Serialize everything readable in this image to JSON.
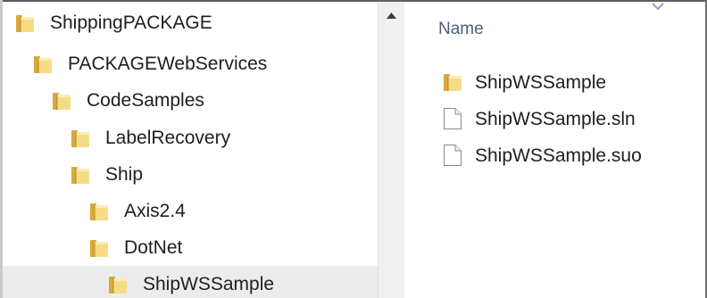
{
  "navigation": {
    "tree": [
      {
        "label": "ShippingPACKAGE",
        "level": 0,
        "selected": false
      },
      {
        "label": "PACKAGEWebServices",
        "level": 1,
        "selected": false
      },
      {
        "label": "CodeSamples",
        "level": 2,
        "selected": false
      },
      {
        "label": "LabelRecovery",
        "level": 3,
        "selected": false
      },
      {
        "label": "Ship",
        "level": 3,
        "selected": false
      },
      {
        "label": "Axis2.4",
        "level": 4,
        "selected": false
      },
      {
        "label": "DotNet",
        "level": 4,
        "selected": false
      },
      {
        "label": "ShipWSSample",
        "level": 5,
        "selected": true
      }
    ]
  },
  "content": {
    "column_header": "Name",
    "items": [
      {
        "name": "ShipWSSample",
        "type": "folder"
      },
      {
        "name": "ShipWSSample.sln",
        "type": "file"
      },
      {
        "name": "ShipWSSample.suo",
        "type": "file"
      }
    ]
  },
  "colors": {
    "folder_light": "#f6dc85",
    "folder_dark": "#d9a93a",
    "header_text": "#4c607a",
    "selection": "#ececec"
  },
  "icons": {
    "folder": "folder-icon",
    "file": "document-icon",
    "scroll_up": "scroll-up-arrow-icon",
    "sort": "sort-arrow-icon"
  }
}
